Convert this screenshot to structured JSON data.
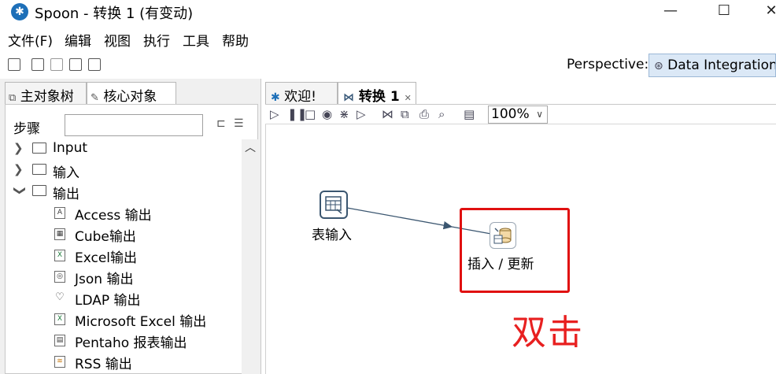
{
  "window": {
    "title": "Spoon - 转换 1 (有变动)",
    "minimize": "—",
    "maximize": "☐",
    "close": "✕"
  },
  "menu": [
    "文件(F)",
    "编辑",
    "视图",
    "执行",
    "工具",
    "帮助"
  ],
  "perspective": {
    "label": "Perspective:",
    "value": "Data Integration"
  },
  "left_panel": {
    "tabs": [
      "主对象树",
      "核心对象"
    ],
    "search_label": "步骤",
    "search_value": "",
    "tree": [
      {
        "label": "Input",
        "type": "folder",
        "expanded": false
      },
      {
        "label": "输入",
        "type": "folder",
        "expanded": false
      },
      {
        "label": "输出",
        "type": "folder",
        "expanded": true
      },
      {
        "label": "Access 输出",
        "type": "leaf",
        "icon": "A"
      },
      {
        "label": "Cube输出",
        "type": "leaf",
        "icon": "▦"
      },
      {
        "label": "Excel输出",
        "type": "leaf",
        "icon": "X"
      },
      {
        "label": "Json 输出",
        "type": "leaf",
        "icon": "◎"
      },
      {
        "label": "LDAP 输出",
        "type": "leaf",
        "icon": "♡"
      },
      {
        "label": "Microsoft Excel 输出",
        "type": "leaf",
        "icon": "X"
      },
      {
        "label": "Pentaho 报表输出",
        "type": "leaf",
        "icon": "▤"
      },
      {
        "label": "RSS 输出",
        "type": "leaf",
        "icon": "≋"
      }
    ]
  },
  "editor": {
    "tabs": [
      {
        "label": "欢迎!",
        "active": false
      },
      {
        "label": "转换 1",
        "active": true,
        "close": "✕"
      }
    ],
    "zoom": "100%",
    "steps": [
      {
        "label": "表输入"
      },
      {
        "label": "插入 / 更新"
      }
    ],
    "annotation": "双击",
    "highlight_color": "#e01010"
  }
}
